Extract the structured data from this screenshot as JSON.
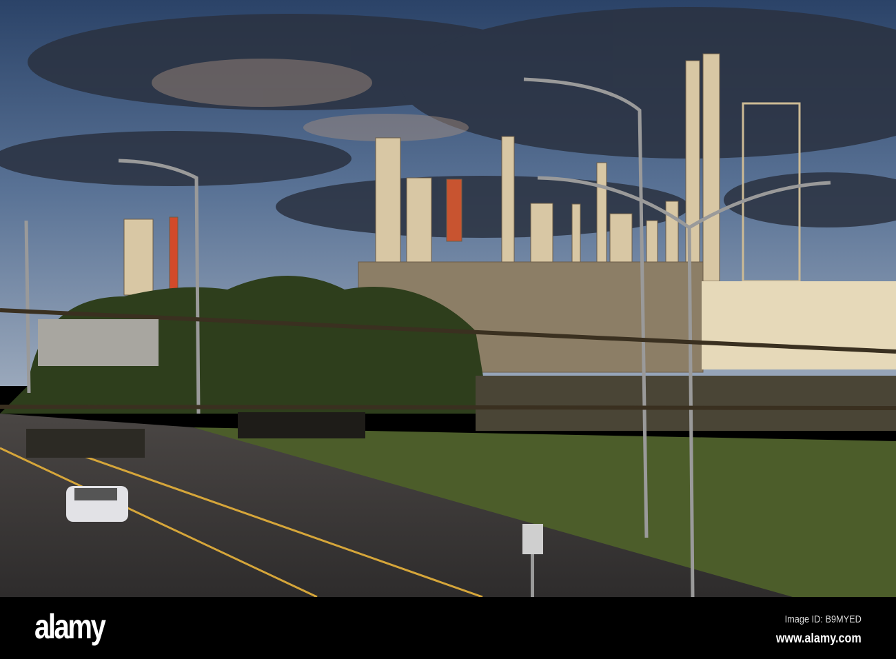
{
  "photo": {
    "subject": "oil refinery beside highway at sunset"
  },
  "watermark": {
    "brand": "alamy",
    "image_id": "Image ID: B9MYED",
    "url": "www.alamy.com"
  },
  "colors": {
    "sky_top": "#2b4368",
    "sky_low": "#7f93ad",
    "cloud": "#2a3140",
    "metal": "#d8c7a4",
    "grass": "#4c5d2a",
    "road": "#3d3b3a",
    "footer": "#000000"
  }
}
